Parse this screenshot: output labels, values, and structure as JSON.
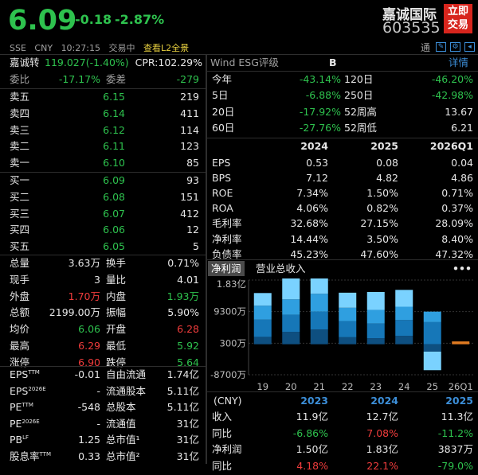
{
  "header": {
    "price": "6.09",
    "change": "-0.18",
    "change_pct": "-2.87%",
    "name": "嘉诚国际",
    "code": "603535",
    "trade_btn": "立即\n交易",
    "sub": {
      "market": "SSE",
      "currency": "CNY",
      "time": "10:27:15",
      "status": "交易中",
      "l2": "查看L2全景",
      "tong": "通"
    }
  },
  "cb": {
    "label": "嘉诚转",
    "value": "119.027(-1.40%)",
    "cpr": "CPR:102.29%"
  },
  "ratio": {
    "l1": "委比",
    "v1": "-17.17%",
    "l2": "委差",
    "v2": "-279"
  },
  "asks": [
    {
      "l": "卖五",
      "p": "6.15",
      "v": "219"
    },
    {
      "l": "卖四",
      "p": "6.14",
      "v": "411"
    },
    {
      "l": "卖三",
      "p": "6.12",
      "v": "114"
    },
    {
      "l": "卖二",
      "p": "6.11",
      "v": "123"
    },
    {
      "l": "卖一",
      "p": "6.10",
      "v": "85"
    }
  ],
  "bids": [
    {
      "l": "买一",
      "p": "6.09",
      "v": "93"
    },
    {
      "l": "买二",
      "p": "6.08",
      "v": "151"
    },
    {
      "l": "买三",
      "p": "6.07",
      "v": "412"
    },
    {
      "l": "买四",
      "p": "6.06",
      "v": "12"
    },
    {
      "l": "买五",
      "p": "6.05",
      "v": "5"
    }
  ],
  "stats": [
    {
      "l1": "总量",
      "v1": "3.63万",
      "c1": "wh",
      "l2": "换手",
      "v2": "0.71%",
      "c2": "wh"
    },
    {
      "l1": "现手",
      "v1": "3",
      "c1": "wh",
      "l2": "量比",
      "v2": "4.01",
      "c2": "wh"
    },
    {
      "l1": "外盘",
      "v1": "1.70万",
      "c1": "up",
      "l2": "内盘",
      "v2": "1.93万",
      "c2": "dn"
    },
    {
      "l1": "总额",
      "v1": "2199.00万",
      "c1": "wh",
      "l2": "振幅",
      "v2": "5.90%",
      "c2": "wh"
    },
    {
      "l1": "均价",
      "v1": "6.06",
      "c1": "dn",
      "l2": "开盘",
      "v2": "6.28",
      "c2": "up"
    },
    {
      "l1": "最高",
      "v1": "6.29",
      "c1": "up",
      "l2": "最低",
      "v2": "5.92",
      "c2": "dn"
    },
    {
      "l1": "涨停",
      "v1": "6.90",
      "c1": "up",
      "l2": "跌停",
      "v2": "5.64",
      "c2": "dn"
    }
  ],
  "fund": [
    {
      "l1": "EPS",
      "s1": "TTM",
      "v1": "-0.01",
      "l2": "自由流通",
      "v2": "1.74亿"
    },
    {
      "l1": "EPS",
      "s1": "2026E",
      "v1": "-",
      "l2": "流通股本",
      "v2": "5.11亿"
    },
    {
      "l1": "PE",
      "s1": "TTM",
      "v1": "-548",
      "l2": "总股本",
      "v2": "5.11亿"
    },
    {
      "l1": "PE",
      "s1": "2026E",
      "v1": "-",
      "l2": "流通值",
      "v2": "31亿"
    },
    {
      "l1": "PB",
      "s1": "LF",
      "v1": "1.25",
      "l2": "总市值¹",
      "v2": "31亿"
    },
    {
      "l1": "股息率",
      "s1": "TTM",
      "v1": "0.33",
      "l2": "总市值²",
      "v2": "31亿"
    }
  ],
  "esg": {
    "label": "Wind ESG评级",
    "grade": "B",
    "detail": "详情"
  },
  "perf": [
    {
      "l1": "今年",
      "v1": "-43.14%",
      "c1": "dn",
      "l2": "120日",
      "v2": "-46.20%",
      "c2": "dn"
    },
    {
      "l1": "5日",
      "v1": "-6.88%",
      "c1": "dn",
      "l2": "250日",
      "v2": "-42.98%",
      "c2": "dn"
    },
    {
      "l1": "20日",
      "v1": "-17.92%",
      "c1": "dn",
      "l2": "52周高",
      "v2": "13.67",
      "c2": "wh"
    },
    {
      "l1": "60日",
      "v1": "-27.76%",
      "c1": "dn",
      "l2": "52周低",
      "v2": "6.21",
      "c2": "wh"
    }
  ],
  "fin": {
    "years": [
      "2024",
      "2025",
      "2026Q1"
    ],
    "rows": [
      {
        "l": "EPS",
        "v": [
          "0.53",
          "0.08",
          "0.04"
        ]
      },
      {
        "l": "BPS",
        "v": [
          "7.12",
          "4.82",
          "4.86"
        ]
      },
      {
        "l": "ROE",
        "v": [
          "7.34%",
          "1.50%",
          "0.71%"
        ]
      },
      {
        "l": "ROA",
        "v": [
          "4.06%",
          "0.82%",
          "0.37%"
        ]
      },
      {
        "l": "毛利率",
        "v": [
          "32.68%",
          "27.15%",
          "28.09%"
        ]
      },
      {
        "l": "净利率",
        "v": [
          "14.44%",
          "3.50%",
          "8.40%"
        ]
      },
      {
        "l": "负债率",
        "v": [
          "45.23%",
          "47.60%",
          "47.32%"
        ]
      }
    ]
  },
  "tabs": {
    "t1": "净利润",
    "t2": "营业总收入",
    "more": "•••"
  },
  "chart_data": {
    "type": "bar",
    "categories": [
      "19",
      "20",
      "21",
      "22",
      "23",
      "24",
      "25",
      "26Q1"
    ],
    "quarters_per_year": [
      "Q1",
      "Q2",
      "Q3",
      "Q4"
    ],
    "series": [
      {
        "values": [
          2100,
          3500,
          4200,
          2000,
          1700,
          2400,
          -2100,
          800
        ]
      },
      {
        "values": [
          4900,
          4900,
          5100,
          4600,
          4200,
          4500,
          6300,
          null
        ]
      },
      {
        "values": [
          4000,
          4400,
          5100,
          3800,
          3900,
          3800,
          3000,
          null
        ]
      },
      {
        "values": [
          3600,
          6000,
          4800,
          4300,
          5100,
          4800,
          -5300,
          null
        ]
      }
    ],
    "yticks": [
      "1.83亿",
      "9300万",
      "300万",
      "-8700万"
    ],
    "ylim": [
      -8700,
      18300
    ],
    "colors": {
      "q1": "#0e4f80",
      "q2": "#1677b8",
      "q3": "#2f9fe0",
      "q4": "#7ad2ff",
      "latest": "#e07b22"
    }
  },
  "annual": {
    "cur": "(CNY)",
    "years": [
      "2023",
      "2024",
      "2025"
    ],
    "rows": [
      {
        "l": "收入",
        "v": [
          "11.9亿",
          "12.7亿",
          "11.3亿"
        ],
        "c": [
          "wh",
          "wh",
          "wh"
        ]
      },
      {
        "l": "同比",
        "v": [
          "-6.86%",
          "7.08%",
          "-11.2%"
        ],
        "c": [
          "dn",
          "up",
          "dn"
        ]
      },
      {
        "l": "净利润",
        "v": [
          "1.50亿",
          "1.83亿",
          "3837万"
        ],
        "c": [
          "wh",
          "wh",
          "wh"
        ]
      },
      {
        "l": "同比",
        "v": [
          "4.18%",
          "22.1%",
          "-79.0%"
        ],
        "c": [
          "up",
          "up",
          "dn"
        ]
      }
    ]
  }
}
